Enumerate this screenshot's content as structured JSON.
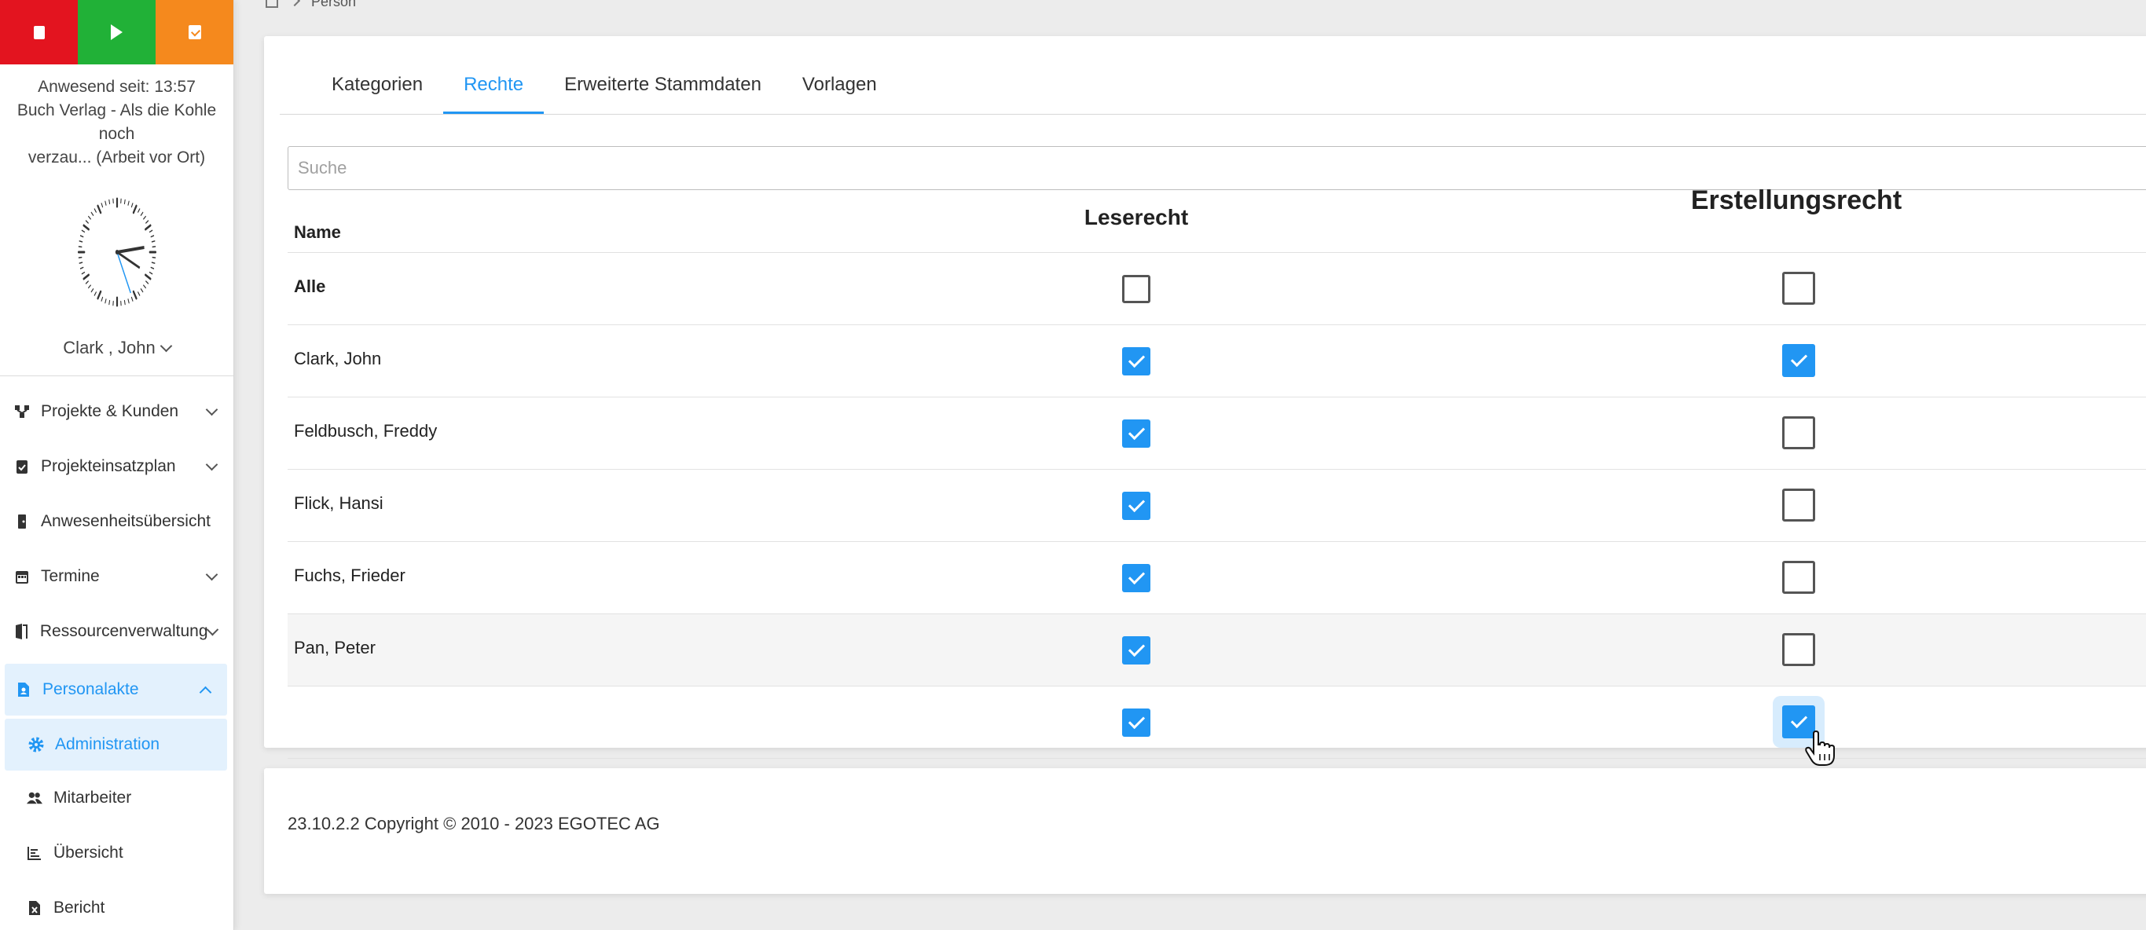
{
  "controls": {
    "stop_icon": "stop-icon",
    "play_icon": "play-icon",
    "pause_icon": "pause-icon",
    "colors": {
      "stop": "#e3141f",
      "play": "#21b137",
      "pause": "#f5891d"
    }
  },
  "presence": {
    "line1": "Anwesend seit: 13:57",
    "line2": "Buch Verlag - Als die Kohle noch",
    "line3": "verzau... (Arbeit vor Ort)"
  },
  "user": {
    "name": "Clark , John"
  },
  "nav": [
    {
      "label": "Projekte & Kunden",
      "icon": "project-tree-icon",
      "expandable": true
    },
    {
      "label": "Projekteinsatzplan",
      "icon": "clipboard-check-icon",
      "expandable": true
    },
    {
      "label": "Anwesenheitsübersicht",
      "icon": "door-icon",
      "expandable": false
    },
    {
      "label": "Termine",
      "icon": "calendar-icon",
      "expandable": true
    },
    {
      "label": "Ressourcenverwaltung",
      "icon": "door-open-icon",
      "expandable": true
    },
    {
      "label": "Personalakte",
      "icon": "file-person-icon",
      "expandable": true,
      "active": true
    },
    {
      "label": "Administration",
      "icon": "gear-icon",
      "sub": true,
      "active": true
    },
    {
      "label": "Mitarbeiter",
      "icon": "users-icon",
      "sub": true
    },
    {
      "label": "Übersicht",
      "icon": "chart-list-icon",
      "sub": true
    },
    {
      "label": "Bericht",
      "icon": "file-excel-icon",
      "sub": true
    }
  ],
  "breadcrumb": {
    "current": "Person"
  },
  "tabs": [
    {
      "label": "Kategorien"
    },
    {
      "label": "Rechte",
      "active": true
    },
    {
      "label": "Erweiterte Stammdaten"
    },
    {
      "label": "Vorlagen"
    }
  ],
  "search": {
    "placeholder": "Suche",
    "value": ""
  },
  "table": {
    "headers": {
      "name": "Name",
      "read": "Leserecht",
      "create": "Erstellungsrecht"
    },
    "rows": [
      {
        "name": "Alle",
        "read": false,
        "create": false
      },
      {
        "name": "Clark, John",
        "read": true,
        "create": true
      },
      {
        "name": "Feldbusch, Freddy",
        "read": true,
        "create": false
      },
      {
        "name": "Flick, Hansi",
        "read": true,
        "create": false
      },
      {
        "name": "Fuchs, Frieder",
        "read": true,
        "create": false
      },
      {
        "name": "Pan, Peter",
        "read": true,
        "create": false
      },
      {
        "name": "",
        "read": true,
        "create": true
      }
    ]
  },
  "footer": {
    "text": "23.10.2.2 Copyright © 2010 - 2023 EGOTEC AG"
  },
  "accent": "#2196f3"
}
